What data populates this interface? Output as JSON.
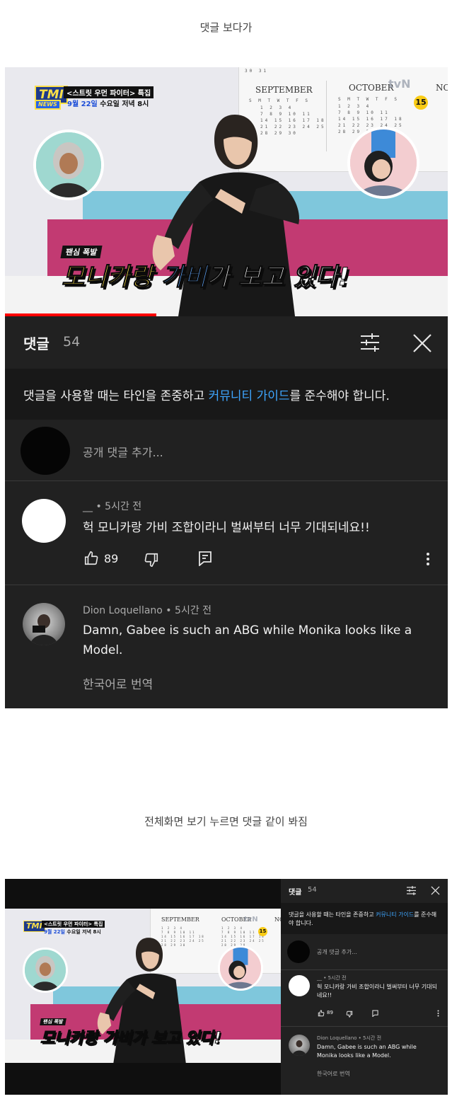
{
  "caption_top": "댓글 보다가",
  "caption_mid": "전체화면 보기 누르면 댓글 같이 봐짐",
  "video": {
    "tmi_logo": "TMI",
    "tmi_sub": "NEWS",
    "tmi_title": "<스트릿 우먼 파이터> 특집",
    "tmi_date": "9월 22일",
    "tmi_time": " 수요일 저녁 8시",
    "cal_sep": "SEPTEMBER",
    "cal_oct": "OCTOBER",
    "cal_nov": "NO",
    "cal_days": "S M T W T F S",
    "cal_top_nums": "30 31",
    "cal_rows": "1 2 3 4\n7 8 9 10 11\n14 15 16 17 18\n21 22 23 24 25\n28 29 30",
    "channel_logo": "tvN",
    "age_badge": "15",
    "fan_tag": "팬심 폭발",
    "caption_a": "모니카랑 ",
    "caption_b": "가비",
    "caption_c": "가 보고 있다!"
  },
  "comments_panel": {
    "title": "댓글",
    "count": "54",
    "notice_prefix": "댓글을 사용할 때는 타인을 존중하고 ",
    "notice_link": "커뮤니티 가이드",
    "notice_suffix": "를 준수해야 합니다.",
    "add_placeholder": "공개 댓글 추가...",
    "comments": [
      {
        "author": "__",
        "time": "5시간 전",
        "text": "헉 모니카랑 가비 조합이라니 벌써부터 너무 기대되네요!!",
        "likes": "89"
      },
      {
        "author": "Dion Loquellano",
        "time": "5시간 전",
        "text": "Damn, Gabee is such an ABG while Monika looks like a Model.",
        "translate": "한국어로 번역"
      }
    ]
  },
  "separator": " • ",
  "icons": {
    "sort": "sliders-icon",
    "close": "close-icon",
    "like": "thumbs-up-icon",
    "dislike": "thumbs-down-icon",
    "reply": "reply-icon",
    "more": "more-vertical-icon"
  },
  "colors": {
    "panel_bg": "#212121",
    "notice_bg": "#181818",
    "link": "#3ea6ff",
    "progress": "#ff0000",
    "caption_yellow": "#fde047",
    "caption_blue": "#60a5fa"
  }
}
